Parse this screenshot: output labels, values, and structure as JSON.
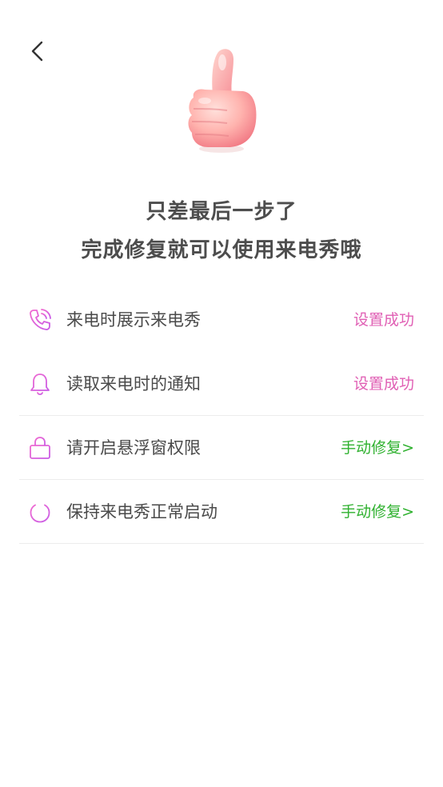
{
  "header": {
    "back_icon": "chevron-left-icon"
  },
  "hero": {
    "icon": "thumbs-up-icon"
  },
  "title": {
    "line1": "只差最后一步了",
    "line2": "完成修复就可以使用来电秀哦"
  },
  "colors": {
    "status_success": "#e05fb4",
    "status_fix": "#2fb12f",
    "icon_gradient_start": "#f06bd0",
    "icon_gradient_end": "#c85ae6"
  },
  "permissions": [
    {
      "icon": "phone-call-icon",
      "label": "来电时展示来电秀",
      "status": "设置成功",
      "state": "done"
    },
    {
      "icon": "bell-icon",
      "label": "读取来电时的通知",
      "status": "设置成功",
      "state": "done"
    },
    {
      "icon": "lock-icon",
      "label": "请开启悬浮窗权限",
      "status": "手动修复>",
      "state": "fix"
    },
    {
      "icon": "power-icon",
      "label": "保持来电秀正常启动",
      "status": "手动修复>",
      "state": "fix"
    }
  ]
}
